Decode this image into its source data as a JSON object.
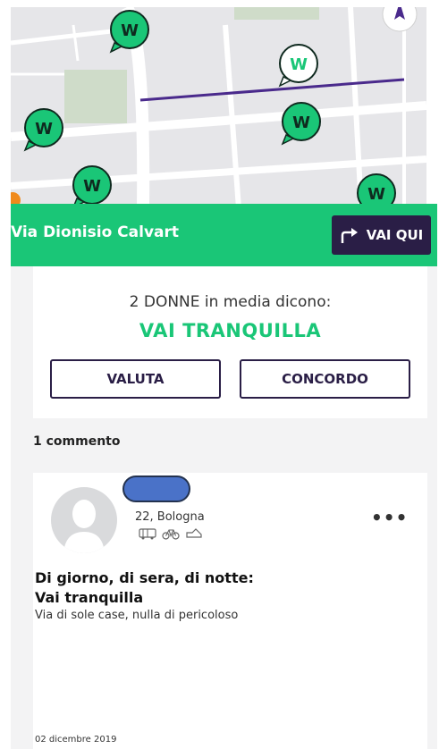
{
  "map": {
    "marker_icon": "w-logo-marker",
    "selected_marker_icon": "w-logo-marker-selected",
    "route_color": "#4a2a8c",
    "compass_icon": "compass-icon"
  },
  "street": {
    "name": "Via Dionisio Calvart",
    "go_label": "VAI QUI",
    "go_icon": "turn-right-arrow-icon"
  },
  "rating": {
    "intro": "2 DONNE in media dicono:",
    "verdict": "VAI TRANQUILLA",
    "rate_label": "VALUTA",
    "agree_label": "CONCORDO"
  },
  "comments": {
    "count_label": "1 commento",
    "items": [
      {
        "user_meta": "22, Bologna",
        "transport_icons": [
          "bus-icon",
          "bike-icon",
          "shoe-icon"
        ],
        "time_of_day": "Di giorno, di sera, di notte:",
        "title": "Vai tranquilla",
        "body": "Via di sole case, nulla di pericoloso",
        "date": "02 dicembre 2019"
      }
    ]
  },
  "colors": {
    "brand_green": "#1ac677",
    "dark_purple": "#2a1e46"
  }
}
